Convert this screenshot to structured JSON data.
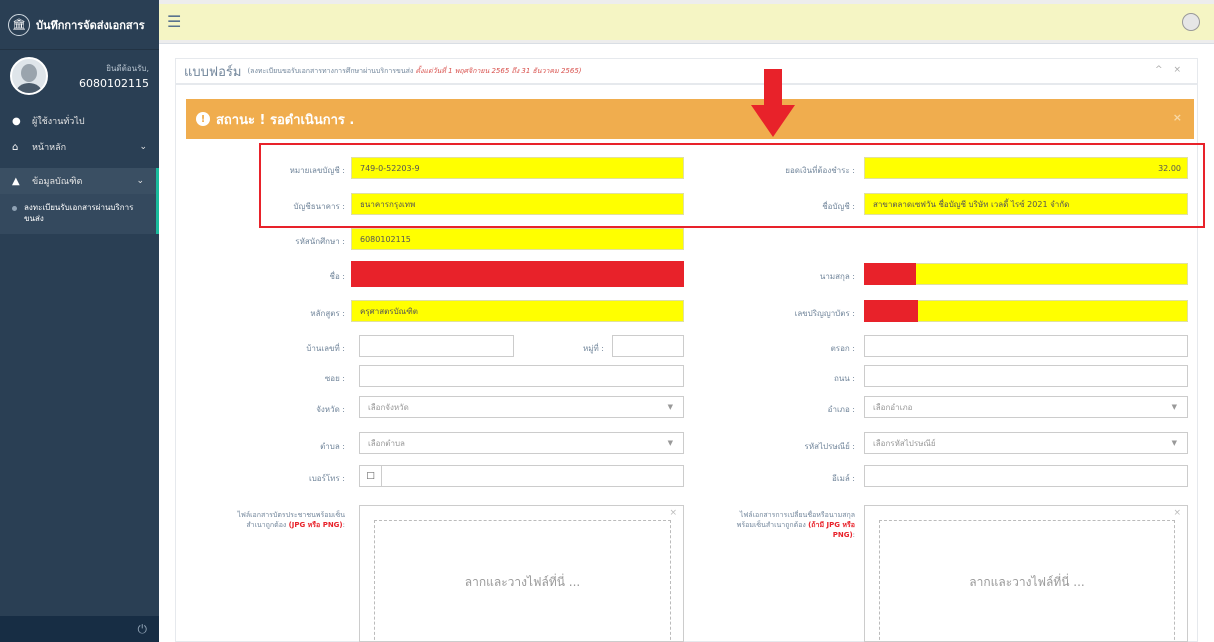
{
  "app": {
    "title": "บันทึกการจัดส่งเอกสาร",
    "logo_icon": "university-icon"
  },
  "profile": {
    "welcome": "ยินดีต้อนรับ,",
    "user_id": "6080102115"
  },
  "sidebar": {
    "items": [
      {
        "label": "ผู้ใช้งานทั่วไป",
        "icon": "user-icon"
      },
      {
        "label": "หน้าหลัก",
        "icon": "home-icon"
      },
      {
        "label": "ข้อมูลบัณฑิต",
        "icon": "graduation-cap-icon"
      }
    ],
    "sub_item": "ลงทะเบียนรับเอกสารผ่านบริการขนส่ง"
  },
  "panel": {
    "title": "แบบฟอร์ม",
    "subtitle": "(ลงทะเบียนขอรับเอกสารทางการศึกษาผ่านบริการขนส่ง",
    "subtitle_date": "ตั้งแต่วันที่ 1 พฤศจิกายน 2565 ถึง 31 ธันวาคม 2565)",
    "tools": "^ ×"
  },
  "status": {
    "text": "สถานะ ! รอดำเนินการ .",
    "close": "×"
  },
  "form": {
    "account_no": {
      "label": "หมายเลขบัญชี :",
      "value": "749-0-52203-9"
    },
    "amount": {
      "label": "ยอดเงินที่ต้องชำระ :",
      "value": "32.00"
    },
    "bank": {
      "label": "บัญชีธนาคาร :",
      "value": "ธนาคารกรุงเทพ"
    },
    "account_name": {
      "label": "ชื่อบัญชี :",
      "value": "สาขาตลาดเซฟวัน ชื่อบัญชี บริษัท เวลดี้ ไรซ์ 2021 จำกัด"
    },
    "student_id": {
      "label": "รหัสนักศึกษา :",
      "value": "6080102115"
    },
    "first_name": {
      "label": "ชื่อ :"
    },
    "last_name": {
      "label": "นามสกุล :"
    },
    "program": {
      "label": "หลักสูตร :",
      "value": "ครุศาสตรบัณฑิต"
    },
    "citizen_id": {
      "label": "เลขปริญญาบัตร :"
    },
    "house_no": {
      "label": "บ้านเลขที่ :"
    },
    "moo": {
      "label": "หมู่ที่ :"
    },
    "alley": {
      "label": "ตรอก :"
    },
    "soi": {
      "label": "ซอย :"
    },
    "road": {
      "label": "ถนน :"
    },
    "province": {
      "label": "จังหวัด :",
      "placeholder": "เลือกจังหวัด"
    },
    "district": {
      "label": "อำเภอ :",
      "placeholder": "เลือกอำเภอ"
    },
    "subdistrict": {
      "label": "ตำบล :",
      "placeholder": "เลือกตำบล"
    },
    "postcode": {
      "label": "รหัสไปรษณีย์ :",
      "placeholder": "เลือกรหัสไปรษณีย์"
    },
    "phone": {
      "label": "เบอร์โทร :"
    },
    "email": {
      "label": "อีเมล์ :"
    },
    "upload1": {
      "label_a": "ไฟล์เอกสารบัตรประชาชนพร้อมเซ็น",
      "label_b": "สำเนาถูกต้อง",
      "label_red": "(JPG หรือ PNG)",
      "label_end": ":",
      "drop": "ลากและวางไฟล์ที่นี่ ..."
    },
    "upload2": {
      "label_a": "ไฟล์เอกสารการเปลี่ยนชื่อหรือนามสกุล",
      "label_b": "พร้อมเซ็นสำเนาถูกต้อง",
      "label_red": "(ถ้ามี JPG หรือ",
      "label_red2": "PNG)",
      "label_end": ":",
      "drop": "ลากและวางไฟล์ที่นี่ ..."
    }
  },
  "colors": {
    "sidebar": "#2a3f54",
    "status": "#f0ad4e",
    "highlight": "#ffff00",
    "annotation": "#e8222a"
  }
}
